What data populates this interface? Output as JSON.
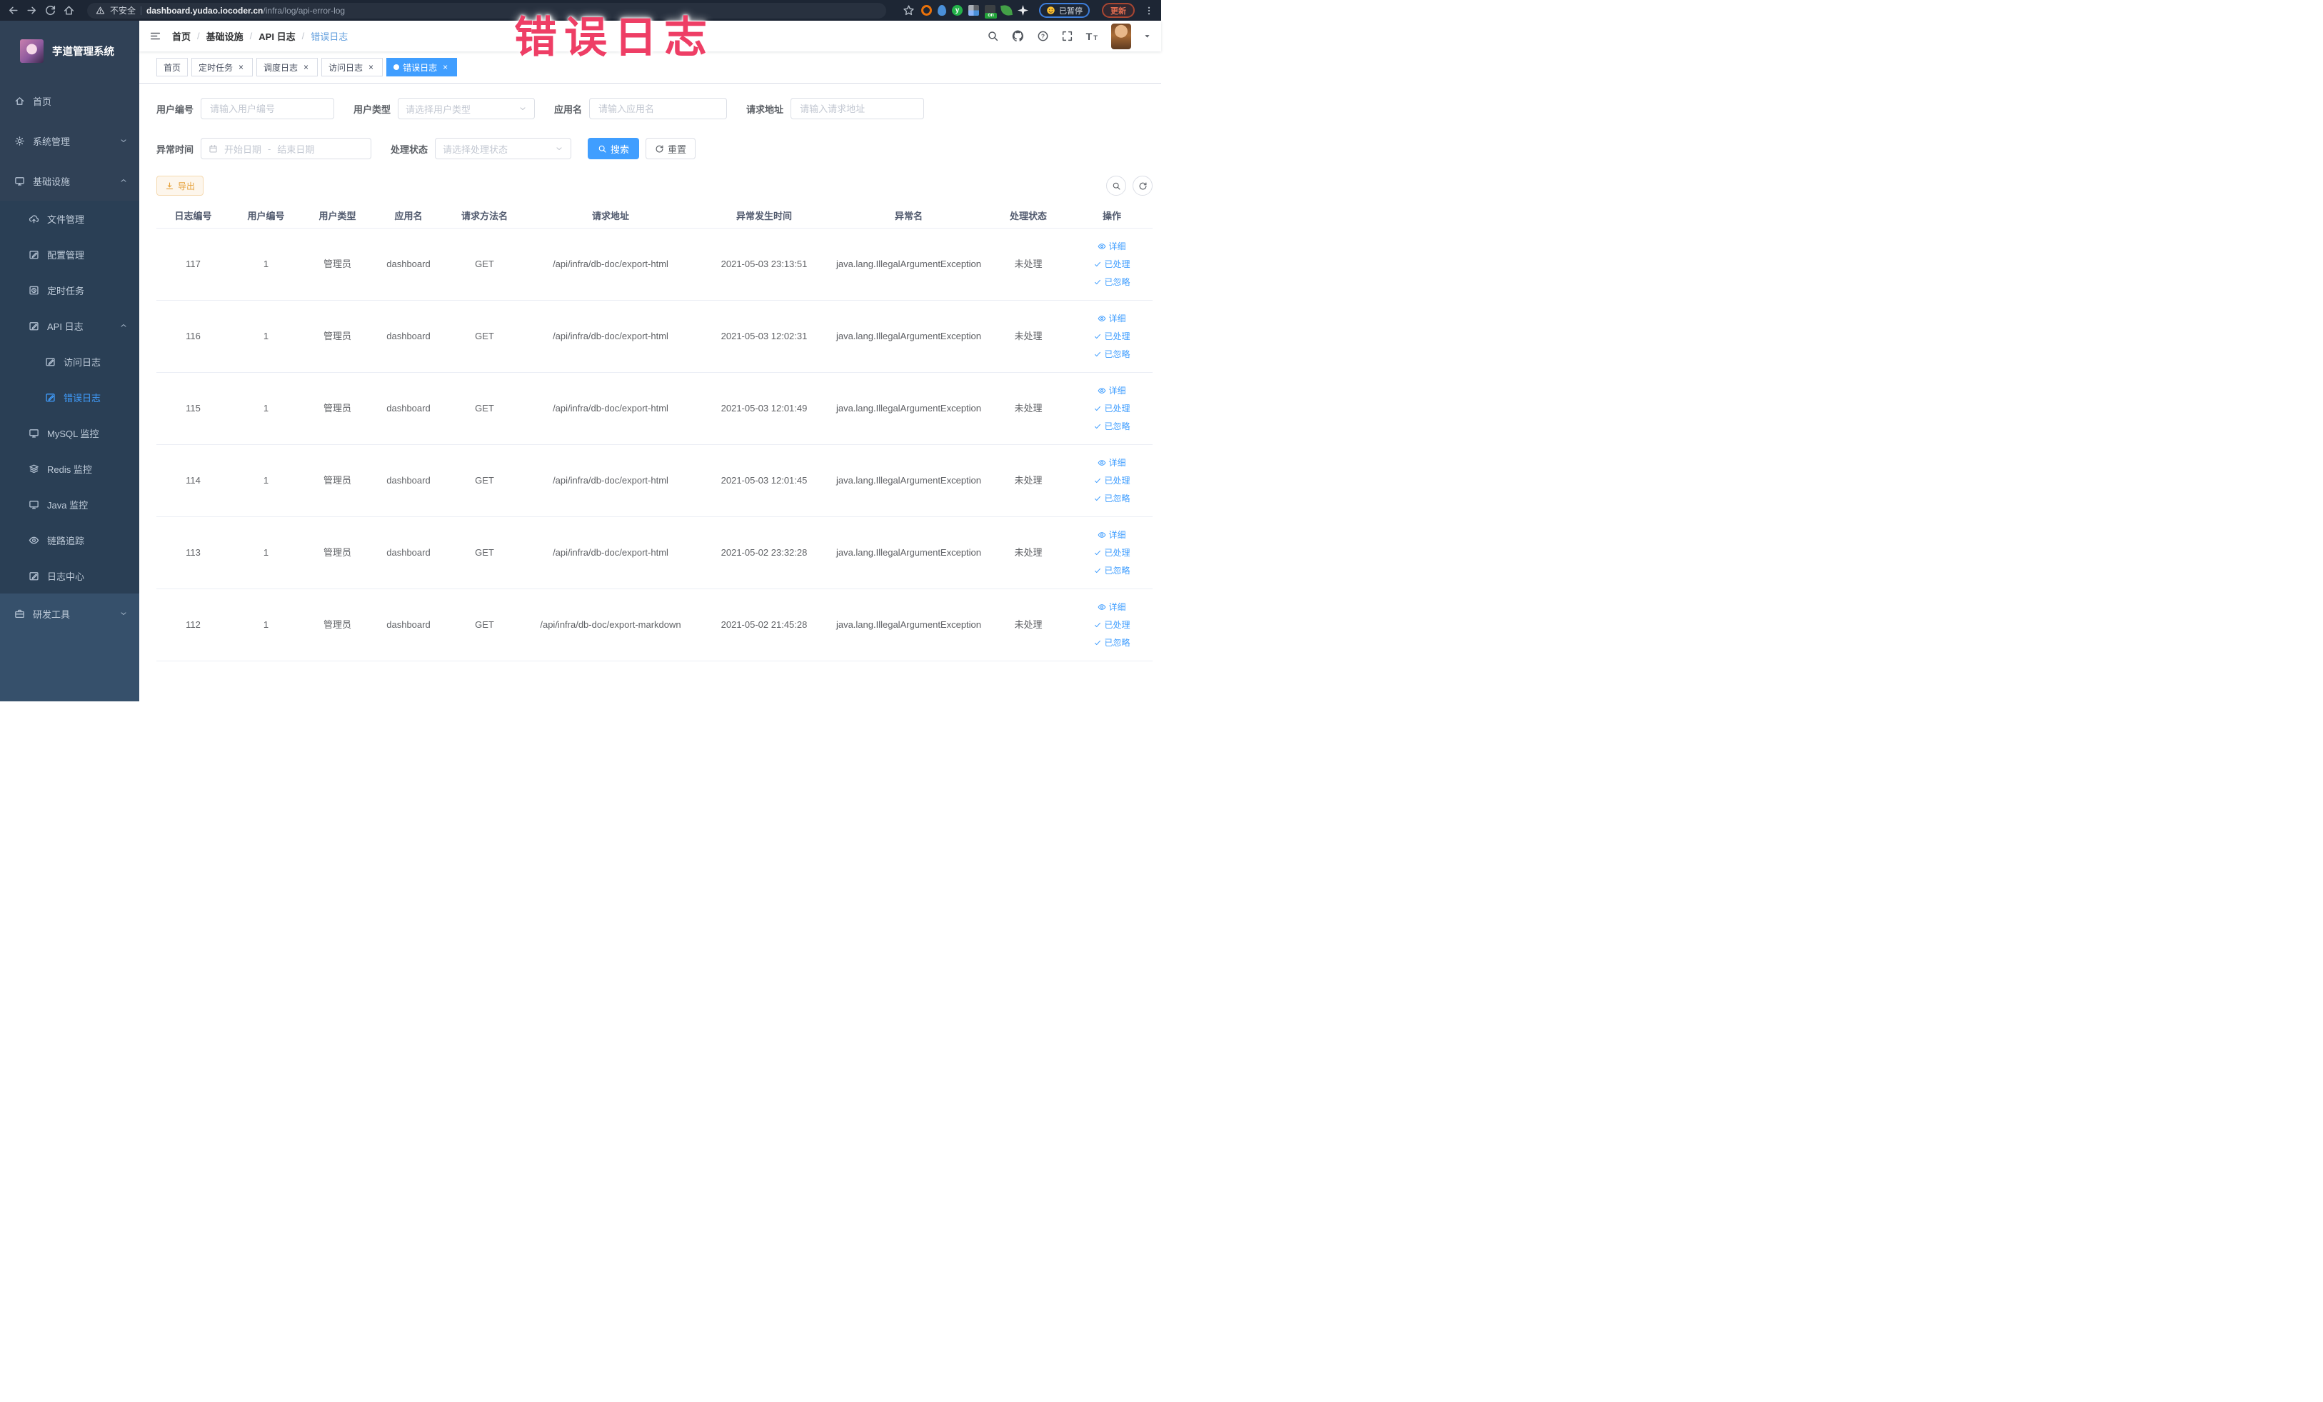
{
  "colors": {
    "accent": "#409eff",
    "sidebar_bg": "#304156",
    "warning": "#e6a23c",
    "annotation": "#ee3e65",
    "active_tab_bg": "#409eff"
  },
  "annotation": {
    "text": "错误日志"
  },
  "browser": {
    "security_label": "不安全",
    "url_host": "dashboard.yudao.iocoder.cn",
    "url_path": "/infra/log/api-error-log",
    "paused_badge": "已暂停",
    "update_button": "更新",
    "extensions": [
      {
        "name": "extension-orange-ring-icon",
        "cls": "ext-orange-ring",
        "glyph": ""
      },
      {
        "name": "extension-blue-drop-icon",
        "cls": "ext-blue-drop",
        "glyph": ""
      },
      {
        "name": "extension-green-y-icon",
        "cls": "ext-green-y",
        "glyph": "y"
      },
      {
        "name": "extension-grid-icon",
        "cls": "ext-grid",
        "glyph": ""
      },
      {
        "name": "extension-on-toggle-icon",
        "cls": "ext-onoff",
        "glyph": ""
      },
      {
        "name": "extension-leaf-icon",
        "cls": "ext-leaf",
        "glyph": ""
      },
      {
        "name": "extension-star-icon",
        "cls": "ext-star",
        "glyph": ""
      }
    ]
  },
  "sidebar": {
    "title": "芋道管理系统",
    "items": [
      {
        "label": "首页",
        "icon": "home-menu-icon",
        "level": 1,
        "sub": false
      },
      {
        "label": "系统管理",
        "icon": "gear-icon",
        "level": 1,
        "sub": false,
        "chevron": "down"
      },
      {
        "label": "基础设施",
        "icon": "monitor-icon",
        "level": 1,
        "sub": false,
        "chevron": "up"
      },
      {
        "label": "文件管理",
        "icon": "cloud-upload-icon",
        "level": 2,
        "sub": true
      },
      {
        "label": "配置管理",
        "icon": "edit-icon",
        "level": 2,
        "sub": true
      },
      {
        "label": "定时任务",
        "icon": "clock-icon",
        "level": 2,
        "sub": true
      },
      {
        "label": "API 日志",
        "icon": "edit-icon",
        "level": 2,
        "sub": true,
        "chevron": "up"
      },
      {
        "label": "访问日志",
        "icon": "edit-icon",
        "level": 3,
        "sub": true
      },
      {
        "label": "错误日志",
        "icon": "edit-icon",
        "level": 3,
        "sub": true,
        "active": true
      },
      {
        "label": "MySQL 监控",
        "icon": "monitor-icon",
        "level": 2,
        "sub": true
      },
      {
        "label": "Redis 监控",
        "icon": "layers-icon",
        "level": 2,
        "sub": true
      },
      {
        "label": "Java 监控",
        "icon": "monitor-icon",
        "level": 2,
        "sub": true
      },
      {
        "label": "链路追踪",
        "icon": "eye-icon",
        "level": 2,
        "sub": true
      },
      {
        "label": "日志中心",
        "icon": "edit-icon",
        "level": 2,
        "sub": true
      },
      {
        "label": "研发工具",
        "icon": "tools-icon",
        "level": 1,
        "sub": false,
        "chevron": "down",
        "bottom": true
      }
    ]
  },
  "header": {
    "breadcrumb": [
      "首页",
      "基础设施",
      "API 日志",
      "错误日志"
    ]
  },
  "tabs": [
    {
      "label": "首页",
      "closable": false,
      "active": false
    },
    {
      "label": "定时任务",
      "closable": true,
      "active": false
    },
    {
      "label": "调度日志",
      "closable": true,
      "active": false
    },
    {
      "label": "访问日志",
      "closable": true,
      "active": false
    },
    {
      "label": "错误日志",
      "closable": true,
      "active": true
    }
  ],
  "filters": {
    "user_id": {
      "label": "用户编号",
      "placeholder": "请输入用户编号"
    },
    "user_type": {
      "label": "用户类型",
      "placeholder": "请选择用户类型"
    },
    "app_name": {
      "label": "应用名",
      "placeholder": "请输入应用名"
    },
    "request_url": {
      "label": "请求地址",
      "placeholder": "请输入请求地址"
    },
    "exception_time": {
      "label": "异常时间",
      "start_placeholder": "开始日期",
      "separator": "-",
      "end_placeholder": "结束日期"
    },
    "process_status": {
      "label": "处理状态",
      "placeholder": "请选择处理状态"
    },
    "search_label": "搜索",
    "reset_label": "重置"
  },
  "toolbar": {
    "export_label": "导出"
  },
  "table": {
    "columns": [
      "日志编号",
      "用户编号",
      "用户类型",
      "应用名",
      "请求方法名",
      "请求地址",
      "异常发生时间",
      "异常名",
      "处理状态",
      "操作"
    ],
    "actions": [
      {
        "label": "详细",
        "icon": "eye-icon"
      },
      {
        "label": "已处理",
        "icon": "check-icon"
      },
      {
        "label": "已忽略",
        "icon": "check-icon"
      }
    ],
    "rows": [
      {
        "id": "117",
        "user_id": "1",
        "user_type": "管理员",
        "app_name": "dashboard",
        "method": "GET",
        "url": "/api/infra/db-doc/export-html",
        "time": "2021-05-03 23:13:51",
        "exception": "java.lang.IllegalArgumentException",
        "status": "未处理"
      },
      {
        "id": "116",
        "user_id": "1",
        "user_type": "管理员",
        "app_name": "dashboard",
        "method": "GET",
        "url": "/api/infra/db-doc/export-html",
        "time": "2021-05-03 12:02:31",
        "exception": "java.lang.IllegalArgumentException",
        "status": "未处理"
      },
      {
        "id": "115",
        "user_id": "1",
        "user_type": "管理员",
        "app_name": "dashboard",
        "method": "GET",
        "url": "/api/infra/db-doc/export-html",
        "time": "2021-05-03 12:01:49",
        "exception": "java.lang.IllegalArgumentException",
        "status": "未处理"
      },
      {
        "id": "114",
        "user_id": "1",
        "user_type": "管理员",
        "app_name": "dashboard",
        "method": "GET",
        "url": "/api/infra/db-doc/export-html",
        "time": "2021-05-03 12:01:45",
        "exception": "java.lang.IllegalArgumentException",
        "status": "未处理"
      },
      {
        "id": "113",
        "user_id": "1",
        "user_type": "管理员",
        "app_name": "dashboard",
        "method": "GET",
        "url": "/api/infra/db-doc/export-html",
        "time": "2021-05-02 23:32:28",
        "exception": "java.lang.IllegalArgumentException",
        "status": "未处理"
      },
      {
        "id": "112",
        "user_id": "1",
        "user_type": "管理员",
        "app_name": "dashboard",
        "method": "GET",
        "url": "/api/infra/db-doc/export-markdown",
        "time": "2021-05-02 21:45:28",
        "exception": "java.lang.IllegalArgumentException",
        "status": "未处理"
      }
    ]
  }
}
